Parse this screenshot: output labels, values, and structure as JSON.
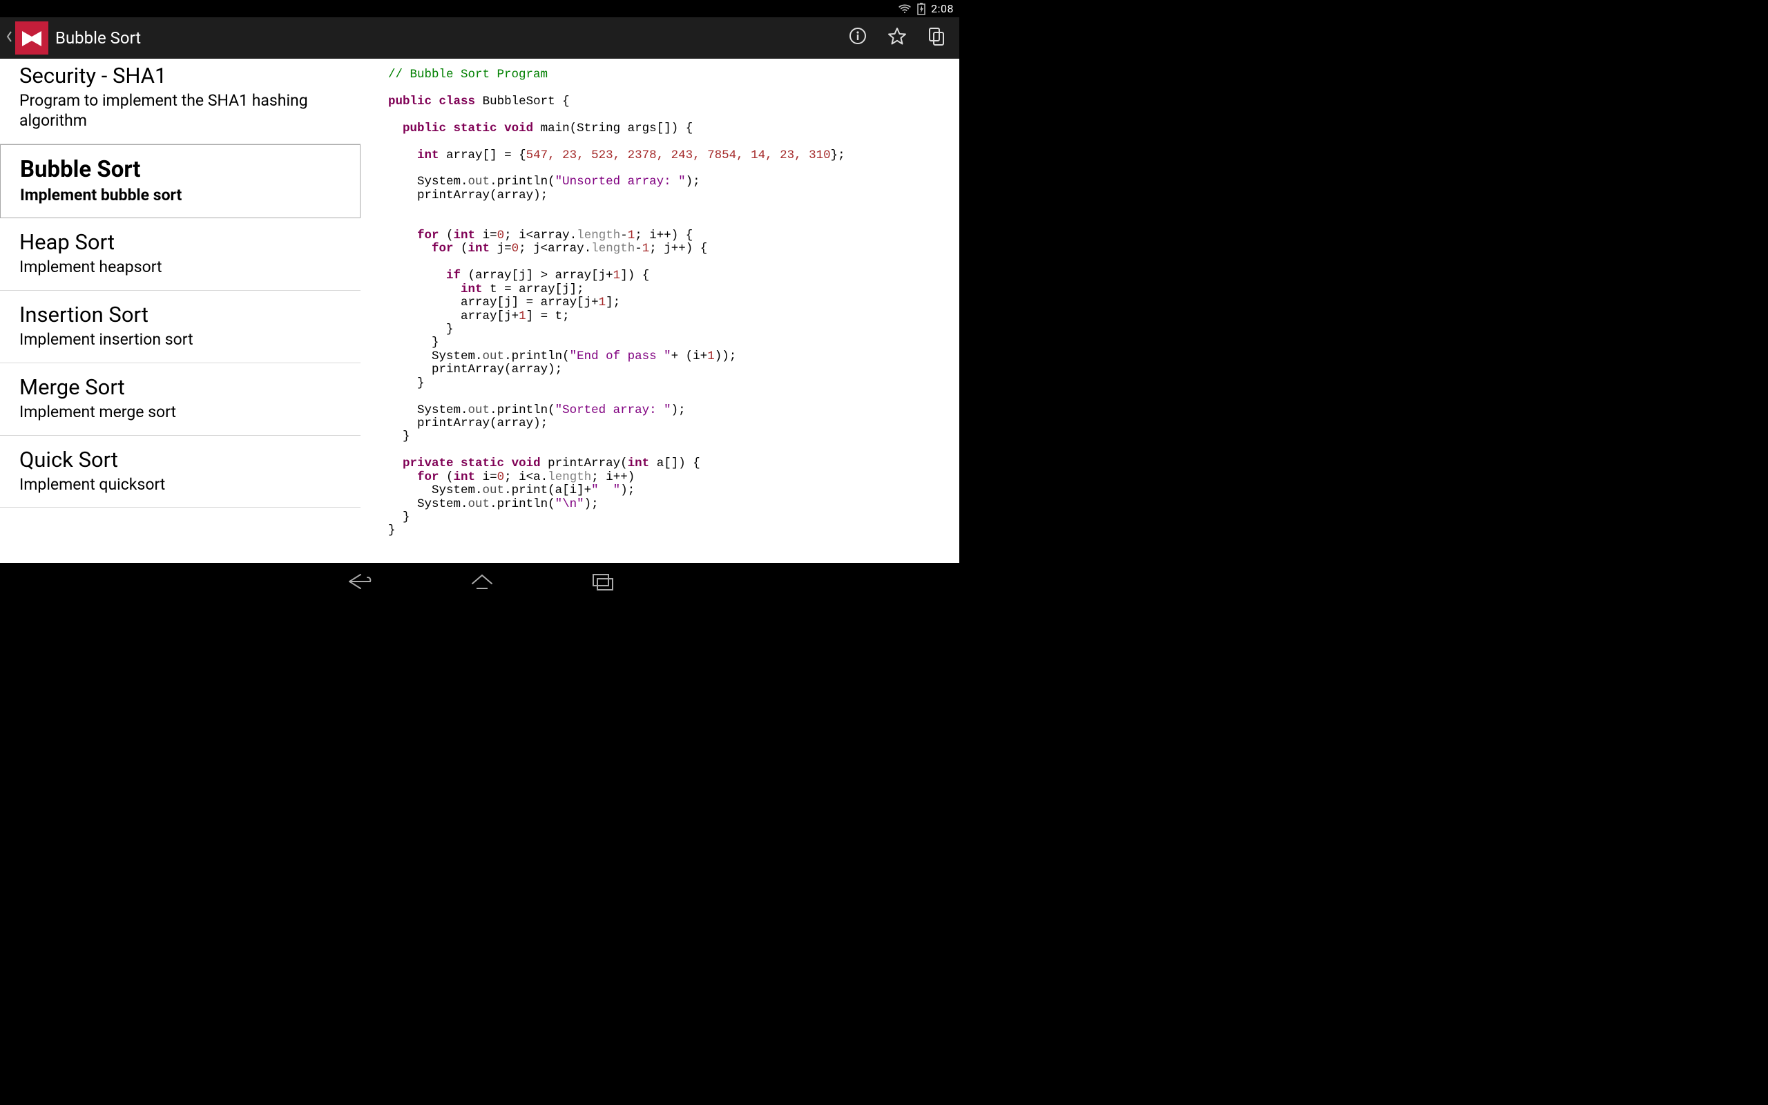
{
  "status": {
    "time": "2:08"
  },
  "appbar": {
    "title": "Bubble Sort"
  },
  "sidebar": {
    "items": [
      {
        "title": "Security - SHA1",
        "desc": "Program to implement the SHA1 hashing algorithm",
        "selected": false
      },
      {
        "title": "Bubble Sort",
        "desc": "Implement bubble sort",
        "selected": true
      },
      {
        "title": "Heap Sort",
        "desc": "Implement heapsort",
        "selected": false
      },
      {
        "title": "Insertion Sort",
        "desc": "Implement insertion sort",
        "selected": false
      },
      {
        "title": "Merge Sort",
        "desc": "Implement merge sort",
        "selected": false
      },
      {
        "title": "Quick Sort",
        "desc": "Implement quicksort",
        "selected": false
      }
    ]
  },
  "code": {
    "comment": "// Bubble Sort Program",
    "array_values": "547, 23, 523, 2378, 243, 7854, 14, 23, 310",
    "str_unsorted": "\"Unsorted array: \"",
    "str_endpass": "\"End of pass \"",
    "str_sorted": "\"Sorted array: \"",
    "str_spaces": "\"  \"",
    "str_nl": "\"\\n\"",
    "num0a": "0",
    "num0b": "0",
    "num1a": "1",
    "num1b": "1",
    "num1c": "1",
    "num1d": "1",
    "num1e": "1",
    "num1f": "1",
    "num0c": "0",
    "kw_public1": "public",
    "kw_class": "class",
    "id_BubbleSort": "BubbleSort",
    "kw_public2": "public",
    "kw_static1": "static",
    "kw_void1": "void",
    "id_main": "main",
    "id_String": "String",
    "id_args": "args",
    "kw_int1": "int",
    "id_array": "array",
    "id_System1": "System",
    "id_out1": "out",
    "id_println1": "println",
    "id_printArray1": "printArray",
    "id_arrayArg1": "array",
    "kw_for1": "for",
    "kw_int2": "int",
    "id_i1": "i",
    "id_i2": "i",
    "id_array2": "array",
    "id_length1": "length",
    "id_i3": "i",
    "kw_for2": "for",
    "kw_int3": "int",
    "id_j1": "j",
    "id_j2": "j",
    "id_array3": "array",
    "id_length2": "length",
    "id_j3": "j",
    "kw_if": "if",
    "id_array4": "array",
    "id_j4": "j",
    "id_array5": "array",
    "id_j5": "j",
    "kw_int4": "int",
    "id_t1": "t",
    "id_array6": "array",
    "id_j6": "j",
    "id_array7": "array",
    "id_j7": "j",
    "id_array8": "array",
    "id_j8": "j",
    "id_array9": "array",
    "id_j9": "j",
    "id_t2": "t",
    "id_System2": "System",
    "id_out2": "out",
    "id_println2": "println",
    "id_i4": "i",
    "id_printArray2": "printArray",
    "id_arrayArg2": "array",
    "id_System3": "System",
    "id_out3": "out",
    "id_println3": "println",
    "id_printArray3": "printArray",
    "id_arrayArg3": "array",
    "kw_private": "private",
    "kw_static2": "static",
    "kw_void2": "void",
    "id_printArray4": "printArray",
    "kw_int5": "int",
    "id_a1": "a",
    "kw_for3": "for",
    "kw_int6": "int",
    "id_i5": "i",
    "id_i6": "i",
    "id_a2": "a",
    "id_length3": "length",
    "id_i7": "i",
    "id_System4": "System",
    "id_out4": "out",
    "id_print": "print",
    "id_a3": "a",
    "id_i8": "i",
    "id_System5": "System",
    "id_out5": "out",
    "id_println4": "println"
  }
}
